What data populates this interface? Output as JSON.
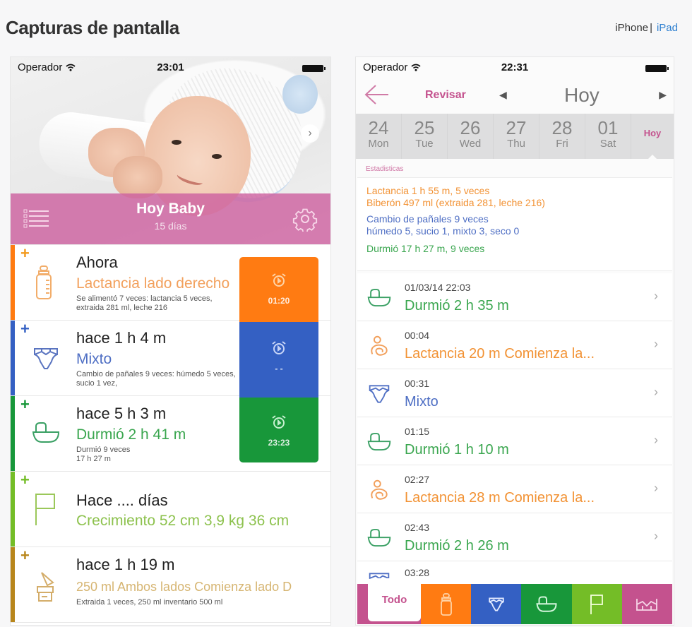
{
  "page": {
    "title": "Capturas de pantalla",
    "device_switch": {
      "iphone": "iPhone",
      "separator": "|",
      "ipad": "iPad"
    }
  },
  "phone1": {
    "status": {
      "carrier": "Operador",
      "time": "23:01"
    },
    "header": {
      "title": "Hoy Baby",
      "subtitle": "15 días"
    },
    "rows": [
      {
        "type": "feeding",
        "color": "#ff7b12",
        "when": "Ahora",
        "detail": "Lactancia lado derecho",
        "note": "Se alimentó 7 veces: lactancia 5 veces, extraida 281 ml, leche 216",
        "timer": "01:20"
      },
      {
        "type": "diaper",
        "color": "#3460c3",
        "when": "hace 1 h 4 m",
        "detail": "Mixto",
        "note": "Cambio de pañales 9 veces: húmedo 5 veces, sucio 1 vez,",
        "timer": "- -"
      },
      {
        "type": "sleep",
        "color": "#18973a",
        "when": "hace 5 h 3 m",
        "detail": "Durmió 2 h 41 m",
        "note": "Durmió 9 veces\n17 h 27 m",
        "timer": "23:23"
      },
      {
        "type": "growth",
        "color": "#74bd27",
        "when": "Hace .... días",
        "detail": "Crecimiento 52 cm 3,9 kg 36 cm",
        "note": ""
      },
      {
        "type": "pump",
        "color": "#b8861b",
        "when": "hace 1 h 19 m",
        "detail": "250 ml  Ambos lados  Comienza lado D",
        "note": "Extraida 1 veces, 250 ml  inventario 500 ml"
      }
    ]
  },
  "phone2": {
    "status": {
      "carrier": "Operador",
      "time": "22:31"
    },
    "nav": {
      "review": "Revisar",
      "prev": "◀",
      "day": "Hoy",
      "next": "▶"
    },
    "days": [
      {
        "num": "24",
        "dow": "Mon"
      },
      {
        "num": "25",
        "dow": "Tue"
      },
      {
        "num": "26",
        "dow": "Wed"
      },
      {
        "num": "27",
        "dow": "Thu"
      },
      {
        "num": "28",
        "dow": "Fri"
      },
      {
        "num": "01",
        "dow": "Sat"
      }
    ],
    "today_label": "Hoy",
    "stats_label": "Estadisticas",
    "stats": {
      "feed1": "Lactancia 1 h 55 m,  5 veces",
      "feed2": "Biberón 497 ml  (extraida 281,  leche 216)",
      "diaper1": "Cambio de pañales 9 veces",
      "diaper2": "húmedo 5,  sucio 1,  mixto 3,  seco 0",
      "sleep": "Durmió 17 h 27 m,  9 veces"
    },
    "entries": [
      {
        "type": "sleep",
        "time": "01/03/14 22:03",
        "detail": "Durmió 2 h 35 m",
        "color": "#3aa64f"
      },
      {
        "type": "nursing",
        "time": "00:04",
        "detail": "Lactancia  20 m Comienza la...",
        "color": "#f29234"
      },
      {
        "type": "diaper",
        "time": "00:31",
        "detail": "Mixto",
        "color": "#4f6fc4"
      },
      {
        "type": "sleep",
        "time": "01:15",
        "detail": "Durmió 1 h 10 m",
        "color": "#3aa64f"
      },
      {
        "type": "nursing",
        "time": "02:27",
        "detail": "Lactancia  28 m Comienza la...",
        "color": "#f29234"
      },
      {
        "type": "sleep",
        "time": "02:43",
        "detail": "Durmió 2 h 26 m",
        "color": "#3aa64f"
      },
      {
        "type": "diaper",
        "time": "03:28",
        "detail": "",
        "color": "#4f6fc4"
      }
    ],
    "tabs": {
      "all": "Todo"
    }
  }
}
